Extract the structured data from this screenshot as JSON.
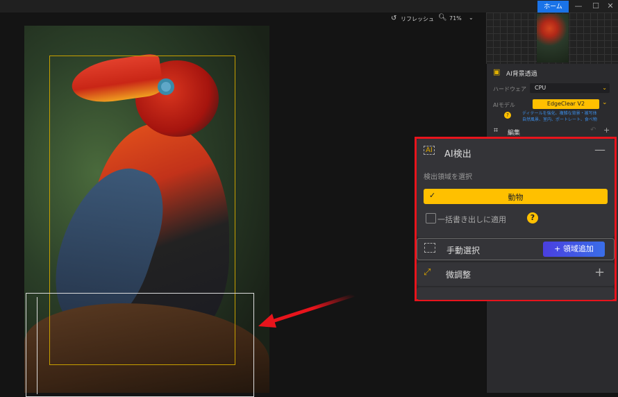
{
  "titlebar": {
    "home_label": "ホーム",
    "minimize": "—",
    "maximize": "☐",
    "close": "✕"
  },
  "toolbar": {
    "refresh_label": "リフレッシュ",
    "zoom_value": "71%"
  },
  "side": {
    "bg_title": "AI背景透過",
    "hardware_label": "ハードウェア",
    "hardware_value": "CPU",
    "model_label": "AIモデル",
    "model_value": "EdgeClear  V2",
    "model_desc_1": "ディテールを強化、複雑な背景・被写体",
    "model_desc_2": "自然風景、室内、ポートレート、食べ物",
    "edit_label": "編集"
  },
  "panel": {
    "ai_detect_title": "AI検出",
    "select_region_label": "検出領域を選択",
    "selected_option": "動物",
    "batch_apply_label": "一括書き出しに適用",
    "manual_select_label": "手動選択",
    "add_region_button": "領域追加",
    "fine_tune_label": "微調整"
  },
  "colors": {
    "accent": "#ffc000",
    "highlight_border": "#e8141c",
    "home_blue": "#1a73e8",
    "add_region": "#4a3fe0"
  }
}
